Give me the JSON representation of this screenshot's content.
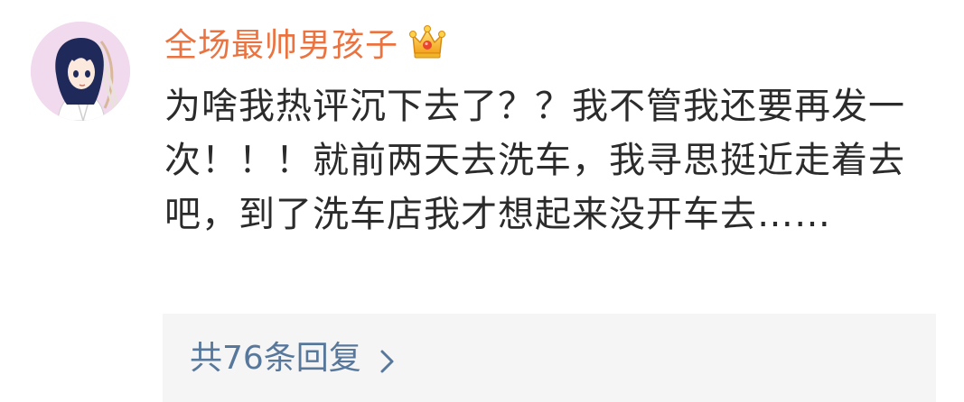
{
  "comment": {
    "username": "全场最帅男孩子",
    "badge_icon": "crown-badge-icon",
    "avatar_icon": "anime-girl-avatar",
    "text": "为啥我热评沉下去了？？我不管我还要再发一次！！！就前两天去洗车，我寻思挺近走着去吧，到了洗车店我才想起来没开车去……",
    "reply_link_label": "共76条回复",
    "reply_chevron_icon": "chevron-right-icon"
  },
  "colors": {
    "username": "#eb7340",
    "text": "#2b2b2b",
    "reply_link": "#57779b",
    "reply_bg": "#f5f5f5",
    "avatar_bg": "#f1d9ee"
  }
}
